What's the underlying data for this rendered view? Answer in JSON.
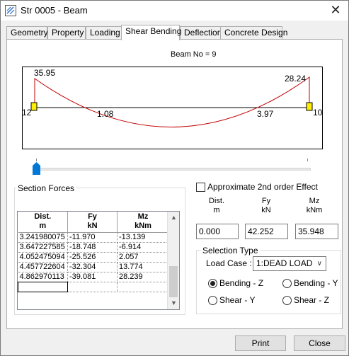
{
  "window": {
    "title": "Str  0005 - Beam",
    "close_glyph": "✕"
  },
  "tabs": [
    "Geometry",
    "Property",
    "Loading",
    "Shear Bending",
    "Deflection",
    "Concrete Design"
  ],
  "active_tab": "Shear Bending",
  "diagram": {
    "beam_label": "Beam No = 9",
    "start_node": "12",
    "end_node": "10",
    "start_value": "35.95",
    "end_value": "28.24",
    "zero_left": "1.08",
    "zero_right": "3.97",
    "curve_color": "#c00000",
    "support_color": "#ffee00"
  },
  "slider": {
    "position_fraction": 0.0
  },
  "section_forces": {
    "label": "Section Forces",
    "columns": [
      {
        "line1": "Dist.",
        "line2": "m"
      },
      {
        "line1": "Fy",
        "line2": "kN"
      },
      {
        "line1": "Mz",
        "line2": "kNm"
      }
    ],
    "rows": [
      [
        "3.241980075",
        "-11.970",
        "-13.139"
      ],
      [
        "3.647227585",
        "-18.748",
        "-6.914"
      ],
      [
        "4.052475094",
        "-25.526",
        "2.057"
      ],
      [
        "4.457722604",
        "-32.304",
        "13.774"
      ],
      [
        "4.862970113",
        "-39.081",
        "28.239"
      ]
    ]
  },
  "second_order": {
    "label": "Approximate 2nd order Effect",
    "checked": false
  },
  "values": {
    "dist_header": {
      "line1": "Dist.",
      "line2": "m"
    },
    "fy_header": {
      "line1": "Fy",
      "line2": "kN"
    },
    "mz_header": {
      "line1": "Mz",
      "line2": "kNm"
    },
    "dist": "0.000",
    "fy": "42.252",
    "mz": "35.948"
  },
  "selection_type": {
    "label": "Selection Type",
    "load_case_label": "Load Case :",
    "load_case_value": "1:DEAD LOAD",
    "radios": [
      {
        "label": "Bending - Z",
        "selected": true
      },
      {
        "label": "Bending - Y",
        "selected": false
      },
      {
        "label": "Shear - Y",
        "selected": false
      },
      {
        "label": "Shear - Z",
        "selected": false
      }
    ]
  },
  "buttons": {
    "print": "Print",
    "close": "Close"
  }
}
